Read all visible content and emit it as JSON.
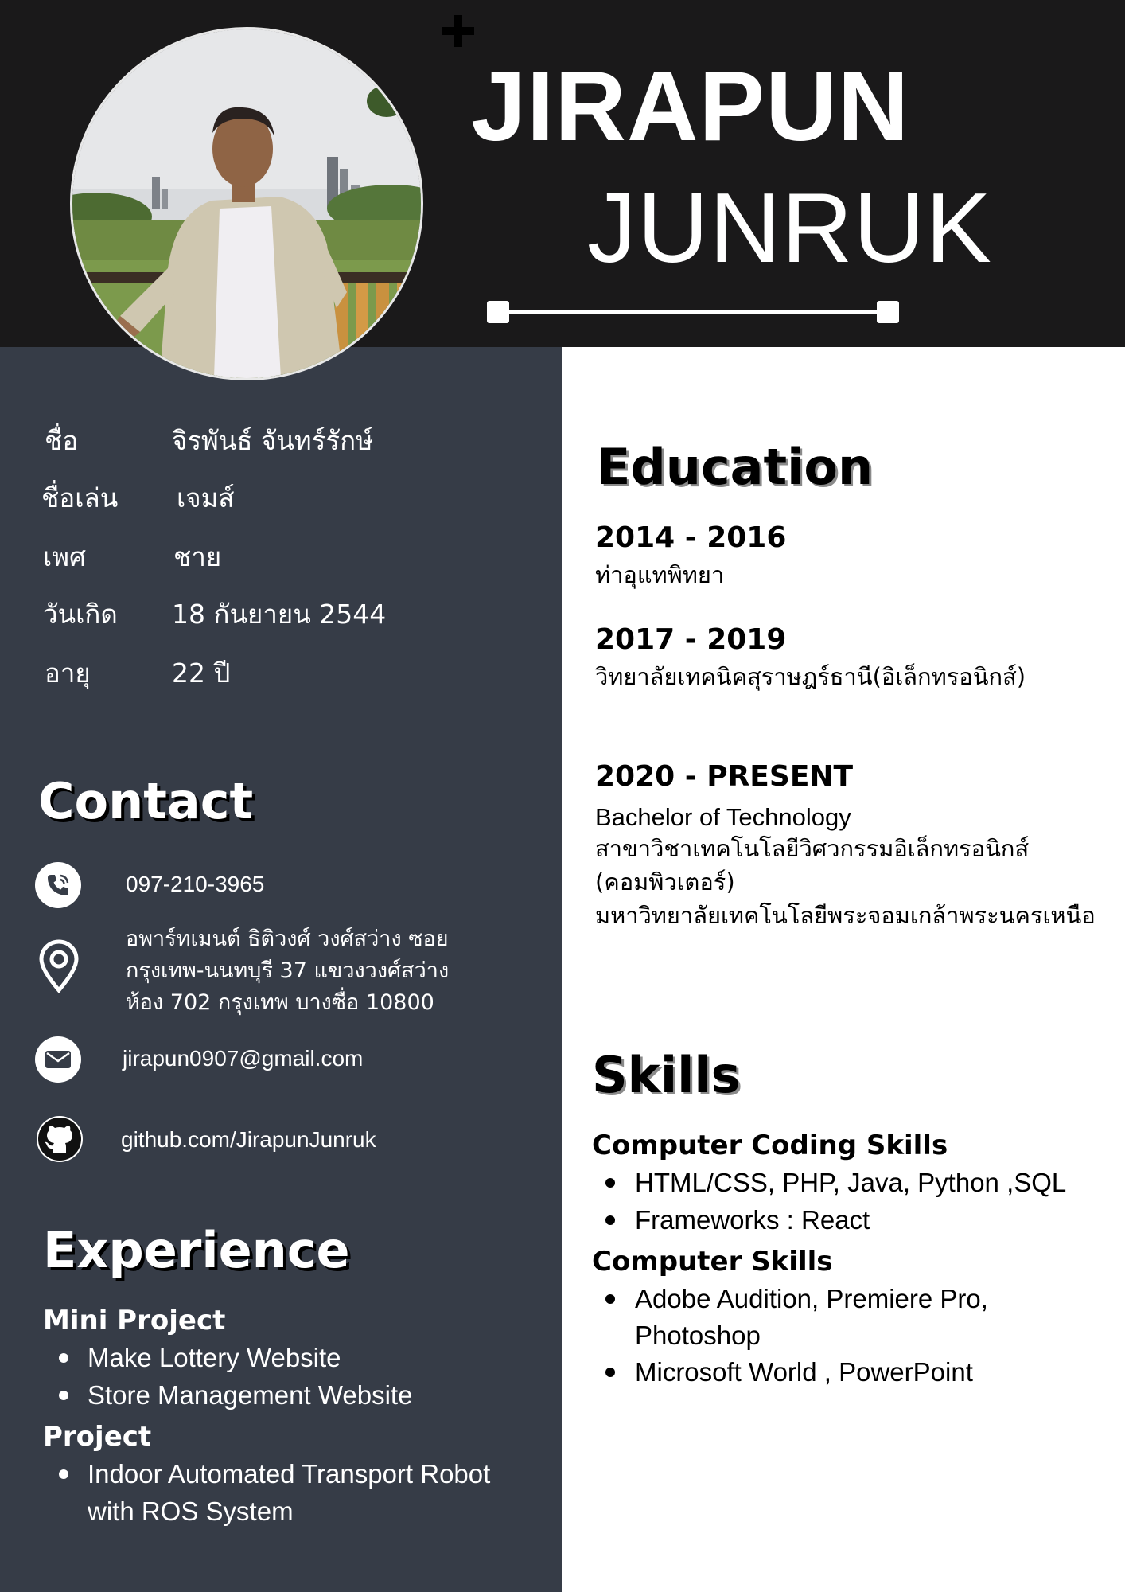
{
  "header": {
    "first_name": "JIRAPUN",
    "last_name": "JUNRUK"
  },
  "profile": {
    "photo_icon": "profile-photo",
    "fields": [
      {
        "label": "ชื่อ",
        "value": "จิรพันธ์ จันทร์รักษ์"
      },
      {
        "label": "ชื่อเล่น",
        "value": "เจมส์"
      },
      {
        "label": "เพศ",
        "value": "ชาย"
      },
      {
        "label": "วันเกิด",
        "value": "18 กันยายน 2544"
      },
      {
        "label": "อายุ",
        "value": "22 ปี"
      }
    ]
  },
  "contact": {
    "title": "Contact",
    "phone": "097-210-3965",
    "address": [
      "อพาร์ทเมนต์ ธิติวงศ์ วงศ์สว่าง ซอย",
      "กรุงเทพ-นนทบุรี 37 แขวงวงศ์สว่าง",
      "ห้อง 702  กรุงเทพ บางซื่อ 10800"
    ],
    "email": "jirapun0907@gmail.com",
    "github": "github.com/JirapunJunruk",
    "icons": [
      "phone-icon",
      "location-pin-icon",
      "mail-icon",
      "github-icon"
    ]
  },
  "experience": {
    "title": "Experience",
    "mini_project_title": "Mini Project",
    "mini_projects": [
      "Make Lottery Website",
      "Store Management Website"
    ],
    "project_title": "Project",
    "projects": [
      "Indoor Automated Transport Robot",
      "with ROS System"
    ]
  },
  "education": {
    "title": "Education",
    "entries": [
      {
        "years": "2014 - 2016",
        "lines": [
          "ท่าอุแทพิทยา"
        ]
      },
      {
        "years": "2017 - 2019",
        "lines": [
          "วิทยาลัยเทคนิคสุราษฎร์ธานี(อิเล็กทรอนิกส์)"
        ]
      },
      {
        "years": "2020 - PRESENT",
        "lines": [
          "Bachelor of Technology",
          "สาขาวิชาเทคโนโลยีวิศวกรรมอิเล็กทรอนิกส์",
          "(คอมพิวเตอร์)",
          "มหาวิทยาลัยเทคโนโลยีพระจอมเกล้าพระนครเหนือ"
        ]
      }
    ]
  },
  "skills": {
    "title": "Skills",
    "coding_title": "Computer Coding Skills",
    "coding": [
      "HTML/CSS, PHP, Java, Python ,SQL",
      "Frameworks : React"
    ],
    "computer_title": "Computer Skills",
    "computer": [
      "Adobe Audition, Premiere Pro,",
      "Photoshop",
      "Microsoft World , PowerPoint"
    ]
  },
  "colors": {
    "header_bg": "#1a191a",
    "sidebar_bg": "#363c47",
    "text_light": "#ffffff",
    "text_dark": "#000000"
  }
}
